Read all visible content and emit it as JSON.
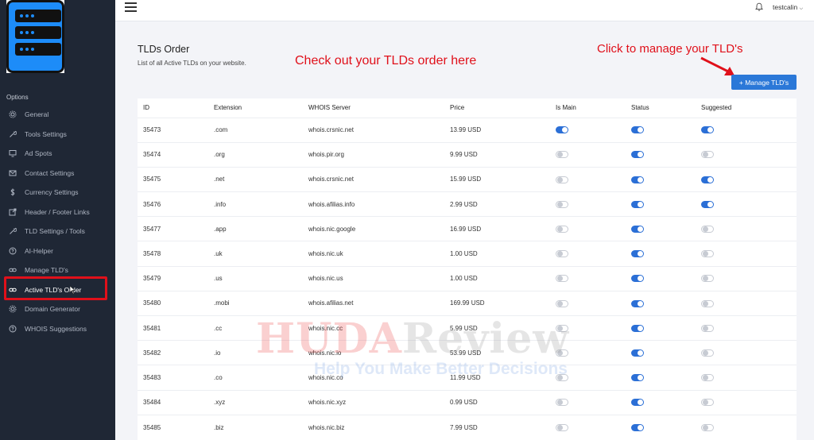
{
  "sidebar": {
    "options_label": "Options",
    "items": [
      {
        "label": "General",
        "icon": "gear-icon"
      },
      {
        "label": "Tools Settings",
        "icon": "wrench-icon"
      },
      {
        "label": "Ad Spots",
        "icon": "monitor-icon"
      },
      {
        "label": "Contact Settings",
        "icon": "mail-icon"
      },
      {
        "label": "Currency Settings",
        "icon": "dollar-icon"
      },
      {
        "label": "Header / Footer Links",
        "icon": "external-link-icon"
      },
      {
        "label": "TLD Settings / Tools",
        "icon": "wrench-icon"
      },
      {
        "label": "AI-Helper",
        "icon": "help-circle-icon"
      },
      {
        "label": "Manage TLD's",
        "icon": "link-icon"
      },
      {
        "label": "Active TLD's Order",
        "icon": "link-icon"
      },
      {
        "label": "Domain Generator",
        "icon": "gear-icon"
      },
      {
        "label": "WHOIS Suggestions",
        "icon": "help-circle-icon"
      }
    ]
  },
  "topbar": {
    "username": "testcalin"
  },
  "main": {
    "title": "TLDs Order",
    "subtitle": "List of all Active TLDs on your website.",
    "annotation_main": "Check out your TLDs order here",
    "annotation_manage": "Click to manage your TLD's",
    "manage_button": "+ Manage TLD's"
  },
  "table": {
    "headers": [
      "ID",
      "Extension",
      "WHOIS Server",
      "Price",
      "Is Main",
      "Status",
      "Suggested"
    ],
    "rows": [
      {
        "id": "35473",
        "ext": ".com",
        "whois": "whois.crsnic.net",
        "price": "13.99 USD",
        "main": true,
        "status": true,
        "suggested": true
      },
      {
        "id": "35474",
        "ext": ".org",
        "whois": "whois.pir.org",
        "price": "9.99 USD",
        "main": false,
        "status": true,
        "suggested": false
      },
      {
        "id": "35475",
        "ext": ".net",
        "whois": "whois.crsnic.net",
        "price": "15.99 USD",
        "main": false,
        "status": true,
        "suggested": true
      },
      {
        "id": "35476",
        "ext": ".info",
        "whois": "whois.afilias.info",
        "price": "2.99 USD",
        "main": false,
        "status": true,
        "suggested": true
      },
      {
        "id": "35477",
        "ext": ".app",
        "whois": "whois.nic.google",
        "price": "16.99 USD",
        "main": false,
        "status": true,
        "suggested": false
      },
      {
        "id": "35478",
        "ext": ".uk",
        "whois": "whois.nic.uk",
        "price": "1.00 USD",
        "main": false,
        "status": true,
        "suggested": false
      },
      {
        "id": "35479",
        "ext": ".us",
        "whois": "whois.nic.us",
        "price": "1.00 USD",
        "main": false,
        "status": true,
        "suggested": false
      },
      {
        "id": "35480",
        "ext": ".mobi",
        "whois": "whois.afilias.net",
        "price": "169.99 USD",
        "main": false,
        "status": true,
        "suggested": false
      },
      {
        "id": "35481",
        "ext": ".cc",
        "whois": "whois.nic.cc",
        "price": "5.99 USD",
        "main": false,
        "status": true,
        "suggested": false
      },
      {
        "id": "35482",
        "ext": ".io",
        "whois": "whois.nic.io",
        "price": "53.99 USD",
        "main": false,
        "status": true,
        "suggested": false
      },
      {
        "id": "35483",
        "ext": ".co",
        "whois": "whois.nic.co",
        "price": "11.99 USD",
        "main": false,
        "status": true,
        "suggested": false
      },
      {
        "id": "35484",
        "ext": ".xyz",
        "whois": "whois.nic.xyz",
        "price": "0.99 USD",
        "main": false,
        "status": true,
        "suggested": false
      },
      {
        "id": "35485",
        "ext": ".biz",
        "whois": "whois.nic.biz",
        "price": "7.99 USD",
        "main": false,
        "status": true,
        "suggested": false
      }
    ]
  },
  "watermark": {
    "line1_part1": "HUDA",
    "line1_part2": "Review",
    "line2": "Help You Make Better Decisions"
  },
  "colors": {
    "sidebar_bg": "#1f2735",
    "accent": "#2b78d8",
    "annotation": "#e0101a"
  }
}
